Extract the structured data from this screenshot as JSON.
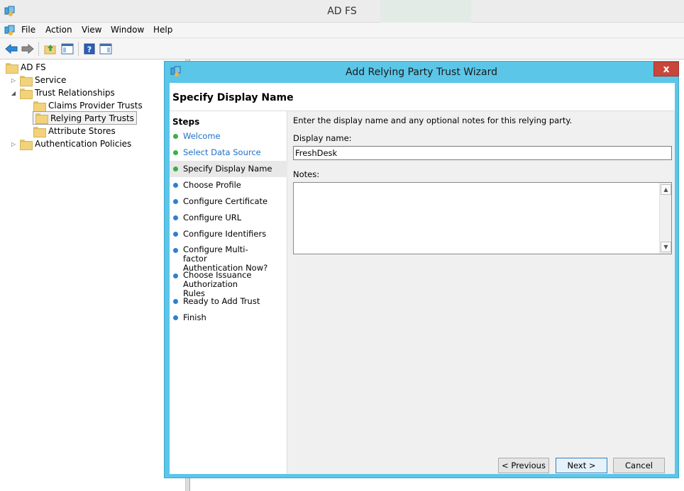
{
  "window": {
    "title": "AD FS"
  },
  "menu": {
    "items": [
      "File",
      "Action",
      "View",
      "Window",
      "Help"
    ]
  },
  "toolbar": {
    "icons": [
      "back-arrow-icon",
      "forward-arrow-icon",
      "up-folder-icon",
      "show-hide-tree-icon",
      "help-icon",
      "action-pane-icon"
    ]
  },
  "tree": {
    "root": "AD FS",
    "service": "Service",
    "trust_relationships": "Trust Relationships",
    "claims_provider_trusts": "Claims Provider Trusts",
    "relying_party_trusts": "Relying Party Trusts",
    "attribute_stores": "Attribute Stores",
    "authentication_policies": "Authentication Policies"
  },
  "dialog": {
    "title": "Add Relying Party Trust Wizard",
    "close_label": "x",
    "heading": "Specify Display Name",
    "steps_title": "Steps",
    "steps": [
      {
        "label": "Welcome",
        "status": "done"
      },
      {
        "label": "Select Data Source",
        "status": "done"
      },
      {
        "label": "Specify Display Name",
        "status": "current"
      },
      {
        "label": "Choose Profile",
        "status": "pending"
      },
      {
        "label": "Configure Certificate",
        "status": "pending"
      },
      {
        "label": "Configure URL",
        "status": "pending"
      },
      {
        "label": "Configure Identifiers",
        "status": "pending"
      },
      {
        "label": "Configure Multi-factor Authentication Now?",
        "status": "pending"
      },
      {
        "label": "Choose Issuance Authorization Rules",
        "status": "pending"
      },
      {
        "label": "Ready to Add Trust",
        "status": "pending"
      },
      {
        "label": "Finish",
        "status": "pending"
      }
    ],
    "intro": "Enter the display name and any optional notes for this relying party.",
    "display_name_label": "Display name:",
    "display_name_value": "FreshDesk",
    "notes_label": "Notes:",
    "notes_value": "",
    "buttons": {
      "previous": "< Previous",
      "next": "Next >",
      "cancel": "Cancel"
    }
  },
  "colors": {
    "dialog_frame": "#5bc6e8",
    "close_button": "#c9463b",
    "step_done_dot": "#3cb043",
    "step_pending_dot": "#2f7fd3",
    "link_text": "#1e6fc4"
  }
}
